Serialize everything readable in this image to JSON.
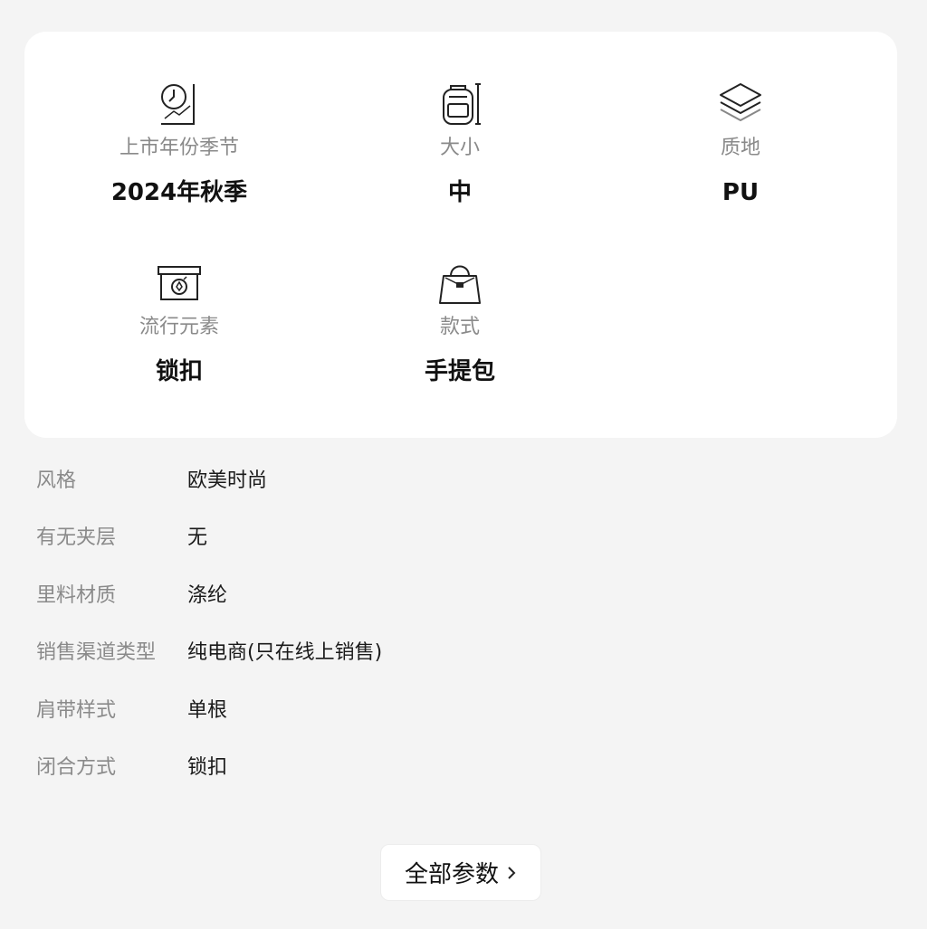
{
  "attributes": [
    {
      "label": "上市年份季节",
      "value": "2024年秋季",
      "icon": "calendar-chart-icon"
    },
    {
      "label": "大小",
      "value": "中",
      "icon": "backpack-size-icon"
    },
    {
      "label": "质地",
      "value": "PU",
      "icon": "layers-icon"
    },
    {
      "label": "流行元素",
      "value": "锁扣",
      "icon": "trend-box-icon"
    },
    {
      "label": "款式",
      "value": "手提包",
      "icon": "handbag-icon"
    }
  ],
  "specs": [
    {
      "key": "风格",
      "value": "欧美时尚"
    },
    {
      "key": "有无夹层",
      "value": "无"
    },
    {
      "key": "里料材质",
      "value": "涤纶"
    },
    {
      "key": "销售渠道类型",
      "value": "纯电商(只在线上销售)"
    },
    {
      "key": "肩带样式",
      "value": "单根"
    },
    {
      "key": "闭合方式",
      "value": "锁扣"
    }
  ],
  "all_params_button": {
    "label": "全部参数"
  },
  "colors": {
    "page_bg": "#f4f4f4",
    "card_bg": "#ffffff",
    "muted_text": "#8a8a8a",
    "strong_text": "#111111"
  }
}
